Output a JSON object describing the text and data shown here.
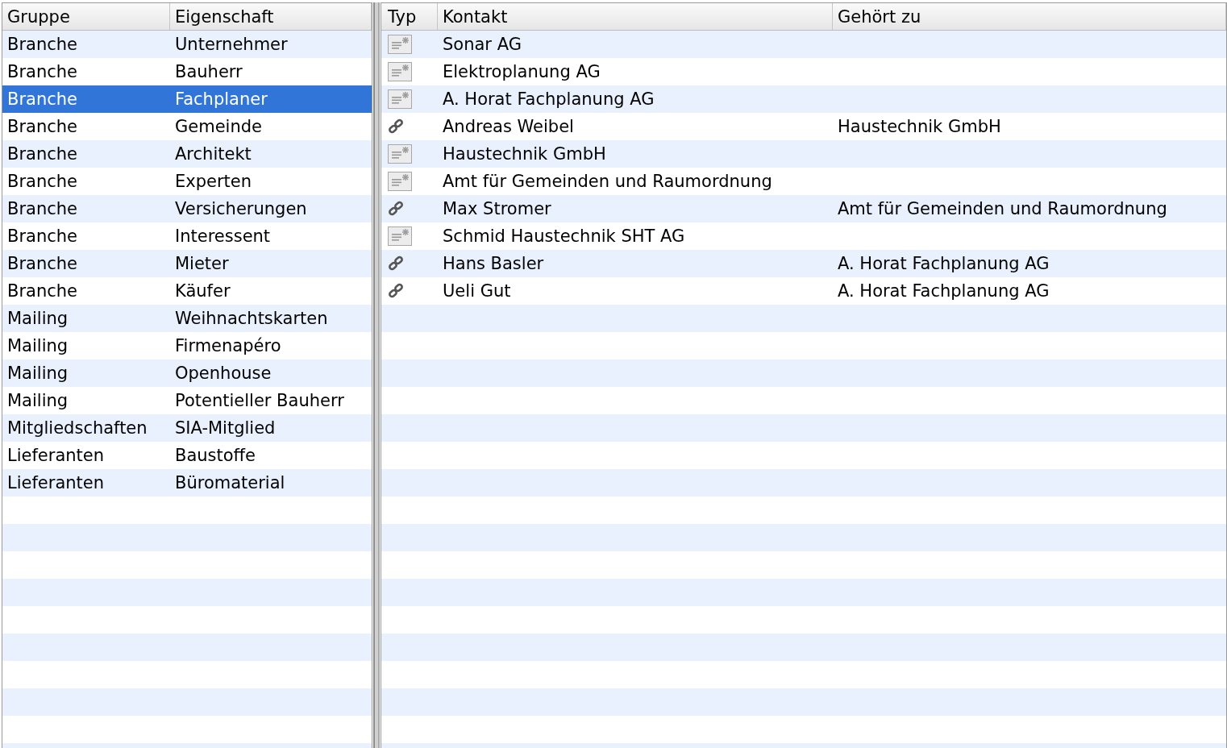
{
  "properties_table": {
    "columns": [
      "Gruppe",
      "Eigenschaft"
    ],
    "rows": [
      {
        "group": "Branche",
        "property": "Unternehmer",
        "selected": false
      },
      {
        "group": "Branche",
        "property": "Bauherr",
        "selected": false
      },
      {
        "group": "Branche",
        "property": "Fachplaner",
        "selected": true
      },
      {
        "group": "Branche",
        "property": "Gemeinde",
        "selected": false
      },
      {
        "group": "Branche",
        "property": "Architekt",
        "selected": false
      },
      {
        "group": "Branche",
        "property": "Experten",
        "selected": false
      },
      {
        "group": "Branche",
        "property": "Versicherungen",
        "selected": false
      },
      {
        "group": "Branche",
        "property": "Interessent",
        "selected": false
      },
      {
        "group": "Branche",
        "property": "Mieter",
        "selected": false
      },
      {
        "group": "Branche",
        "property": "Käufer",
        "selected": false
      },
      {
        "group": "Mailing",
        "property": "Weihnachtskarten",
        "selected": false
      },
      {
        "group": "Mailing",
        "property": "Firmenapéro",
        "selected": false
      },
      {
        "group": "Mailing",
        "property": "Openhouse",
        "selected": false
      },
      {
        "group": "Mailing",
        "property": "Potentieller Bauherr",
        "selected": false
      },
      {
        "group": "Mitgliedschaften",
        "property": "SIA-Mitglied",
        "selected": false
      },
      {
        "group": "Lieferanten",
        "property": "Baustoffe",
        "selected": false
      },
      {
        "group": "Lieferanten",
        "property": "Büromaterial",
        "selected": false
      }
    ]
  },
  "contacts_table": {
    "columns": [
      "Typ",
      "Kontakt",
      "Gehört zu"
    ],
    "rows": [
      {
        "kind": "company",
        "contact": "Sonar AG",
        "belongs_to": ""
      },
      {
        "kind": "company",
        "contact": "Elektroplanung AG",
        "belongs_to": ""
      },
      {
        "kind": "company",
        "contact": "A. Horat Fachplanung AG",
        "belongs_to": ""
      },
      {
        "kind": "person",
        "contact": "Andreas Weibel",
        "belongs_to": "Haustechnik GmbH"
      },
      {
        "kind": "company",
        "contact": "Haustechnik GmbH",
        "belongs_to": ""
      },
      {
        "kind": "company",
        "contact": "Amt für Gemeinden und Raumordnung",
        "belongs_to": ""
      },
      {
        "kind": "person",
        "contact": "Max Stromer",
        "belongs_to": "Amt für Gemeinden und Raumordnung"
      },
      {
        "kind": "company",
        "contact": "Schmid Haustechnik SHT AG",
        "belongs_to": ""
      },
      {
        "kind": "person",
        "contact": "Hans Basler",
        "belongs_to": "A. Horat Fachplanung AG"
      },
      {
        "kind": "person",
        "contact": "Ueli Gut",
        "belongs_to": "A. Horat Fachplanung AG"
      }
    ]
  }
}
